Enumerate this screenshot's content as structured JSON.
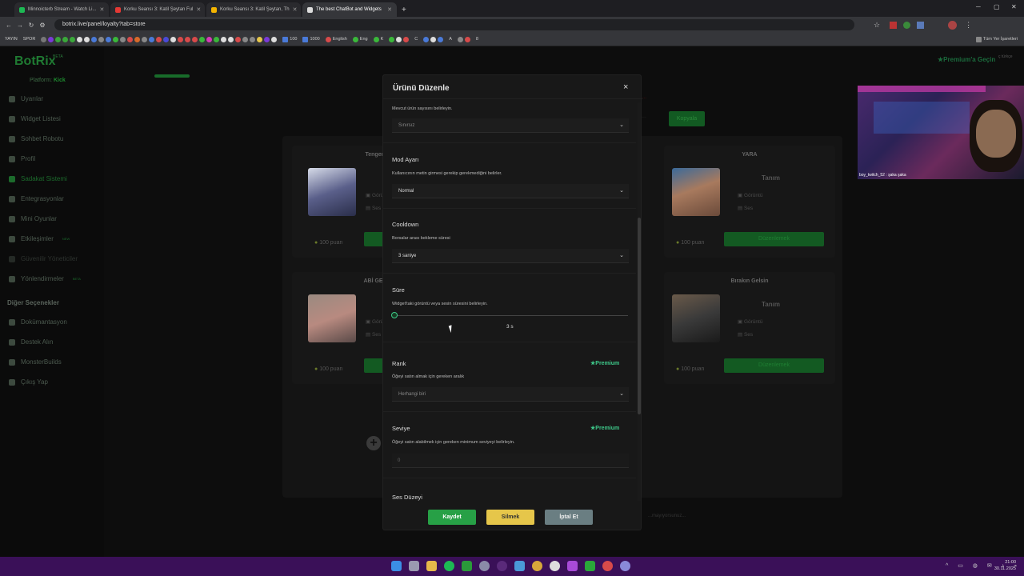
{
  "browser": {
    "tabs": [
      {
        "label": "Minnoicterb Stream - Watch Li...",
        "color": "#1db954"
      },
      {
        "label": "Korku Seansı 3: Katil Şeytan Ful",
        "color": "#e53935"
      },
      {
        "label": "Korku Seansı 3: Katil Şeytan, Th",
        "color": "#f4b400"
      },
      {
        "label": "The best ChatBot and Widgets",
        "color": "#dddddd"
      }
    ],
    "url": "botrix.live/panel/loyalty?tab=store",
    "bookmarks_left": [
      "YAYIN",
      "SPOR"
    ],
    "bookmarks_right": [
      "100",
      "1000",
      "English",
      "Eng",
      "K",
      "C",
      "A",
      "8"
    ],
    "all_bookmarks": "Tüm Yer İşaretleri"
  },
  "sidebar": {
    "logo": "BotRix",
    "beta": "BETA",
    "platform_label": "Platform:",
    "platform_value": "Kick",
    "items": [
      {
        "label": "Uyarılar"
      },
      {
        "label": "Widget Listesi"
      },
      {
        "label": "Sohbet Robotu"
      },
      {
        "label": "Profil"
      },
      {
        "label": "Sadakat Sistemi"
      },
      {
        "label": "Entegrasyonlar"
      },
      {
        "label": "Mini Oyunlar"
      },
      {
        "label": "Etkileşimler",
        "badge": "NEW"
      },
      {
        "label": "Güvenilir Yöneticiler"
      },
      {
        "label": "Yönlendirmeler",
        "badge": "BETA"
      }
    ],
    "other_heading": "Diğer Seçenekler",
    "other_items": [
      {
        "label": "Dokümantasyon"
      },
      {
        "label": "Destek Alın"
      },
      {
        "label": "MonsterBuilds"
      },
      {
        "label": "Çıkış Yap"
      }
    ]
  },
  "header": {
    "premium_link": "Premium'a Geçin",
    "lang": "ç\ntürkçe"
  },
  "store": {
    "copy_button": "Kopyala",
    "faint_bottom": "...mayıyorsunuz...",
    "cards": [
      {
        "title": "Tengen S",
        "desc": "",
        "view": "Görünt",
        "sound": "Ses",
        "points": "100 puan",
        "button": "",
        "thumb_color": "#6a6f8a"
      },
      {
        "title": "YARA",
        "desc": "Tanım",
        "view": "Görüntü",
        "sound": "Ses",
        "points": "100 puan",
        "button": "Düzenlemek",
        "thumb_color": "#6e4a3c"
      },
      {
        "title": "ABİ GELİY",
        "desc": "",
        "view": "Görünt",
        "sound": "Ses",
        "points": "100 puan",
        "button": "",
        "thumb_color": "#7a6258"
      },
      {
        "title": "Bırakın Gelsin",
        "desc": "Tanım",
        "view": "Görüntü",
        "sound": "Ses",
        "points": "100 puan",
        "button": "Düzenlemek",
        "thumb_color": "#4a4038"
      }
    ]
  },
  "modal": {
    "title": "Ürünü Düzenle",
    "close": "×",
    "stock_desc": "Mevcut ürün sayısını belirleyin.",
    "stock_value": "Sınırsız",
    "mod_title": "Mod Ayarı",
    "mod_desc": "Kullanıcının metin girmesi gerekip gerekmediğini belirler.",
    "mod_value": "Normal",
    "cooldown_title": "Cooldown",
    "cooldown_desc": "Borsalar arası bekleme süresi",
    "cooldown_value": "3 saniye",
    "duration_title": "Süre",
    "duration_desc": "Widget'taki görüntü veya sesin süresini belirleyin.",
    "duration_value": "3 s",
    "duration_level": 0.0,
    "rank_title": "Rank",
    "rank_desc": "Öğeyi satın almak için gereken aralık",
    "rank_value": "Herhangi biri",
    "premium_badge": "Premium",
    "level_title": "Seviye",
    "level_desc": "Öğeyi satın alabilmek için gereken minimum seviyeyi belirleyin.",
    "level_value": "0",
    "volume_title": "Ses Düzeyi",
    "save": "Kaydet",
    "delete": "Silmek",
    "cancel": "İptal Et"
  },
  "webcam": {
    "chat": "boy_twitch_52 : şaka şaka"
  },
  "taskbar": {
    "time": "21:00",
    "date": "30.11.2025"
  }
}
